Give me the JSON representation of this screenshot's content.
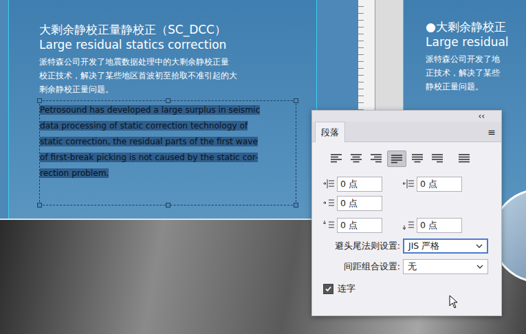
{
  "document": {
    "left_page": {
      "title": "大剩余静校正量静校正（SC_DCC）",
      "subtitle": "Large residual statics correction",
      "cn_lines": [
        "派特森公司开发了地震数据处理中的大剩余静校正量",
        "校正技术，解决了某些地区首波初至拾取不准引起的大",
        "剩余静校正量问题。"
      ],
      "en_lines": [
        "Petrosound has developed a large surplus in seismic",
        "data processing of static correction technology of",
        "static correction, the residual parts of the first wave",
        "of first-break picking is not caused by the static cor-",
        "rection problem."
      ],
      "en_selected": true
    },
    "right_page": {
      "title": "●大剩余静校正",
      "subtitle": "Large residual",
      "cn_lines": [
        "派特森公司开发了地",
        "正技术，解决了某些",
        "静校正量问题。"
      ]
    }
  },
  "panel": {
    "collapse": "‹‹",
    "tab": "段落",
    "menu": "≡",
    "align_buttons": [
      {
        "kind": "left",
        "selected": false
      },
      {
        "kind": "center",
        "selected": false
      },
      {
        "kind": "right",
        "selected": false
      },
      {
        "kind": "justify-left",
        "selected": true
      },
      {
        "kind": "justify-center",
        "selected": false
      },
      {
        "kind": "justify-right",
        "selected": false
      },
      {
        "kind": "justify-all",
        "selected": false
      }
    ],
    "field_rows": [
      [
        {
          "kind": "left-indent",
          "value": "0 点"
        },
        {
          "kind": "right-indent",
          "value": "0 点"
        }
      ],
      [
        {
          "kind": "first-line-indent",
          "value": "0 点"
        }
      ],
      [
        {
          "kind": "space-before",
          "value": "0 点"
        },
        {
          "kind": "space-after",
          "value": "0 点"
        }
      ]
    ],
    "selects": [
      {
        "label": "避头尾法则设置:",
        "value": "JIS 严格",
        "focused": true
      },
      {
        "label": "间距组合设置:",
        "value": "无",
        "focused": false
      }
    ],
    "checkbox": {
      "label": "连字",
      "checked": true
    }
  }
}
